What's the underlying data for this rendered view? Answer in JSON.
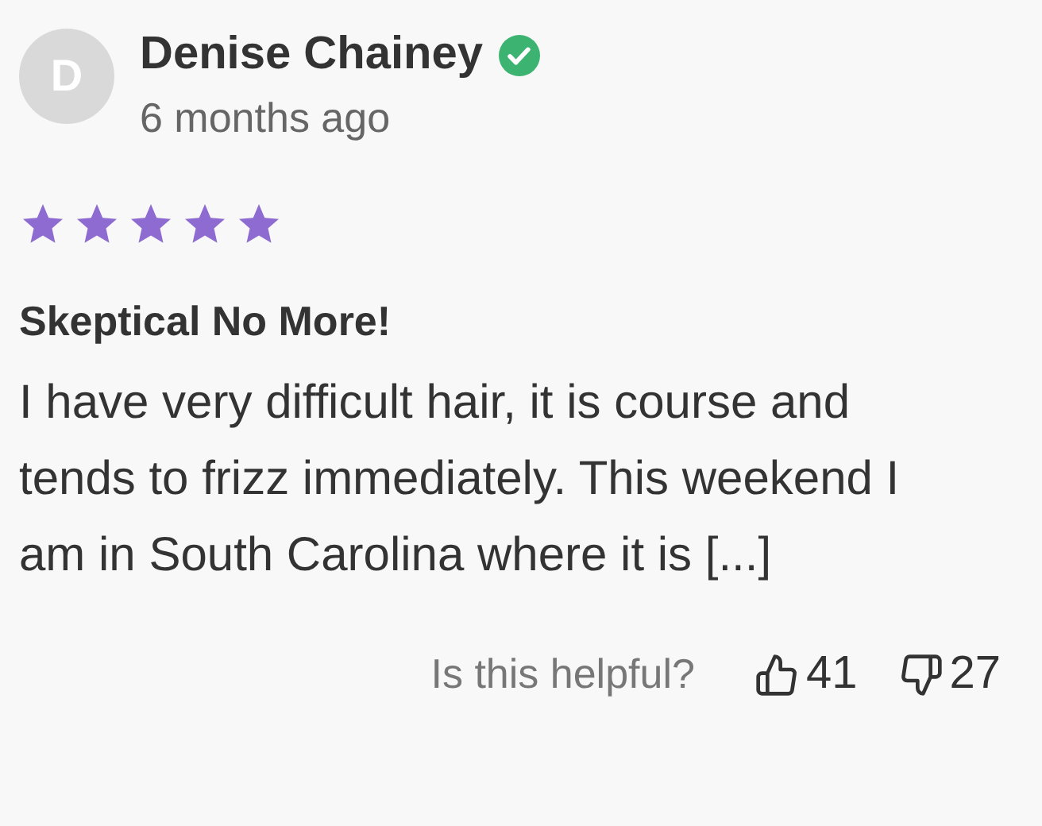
{
  "review": {
    "avatar_initial": "D",
    "author": "Denise Chainey",
    "verified": true,
    "date": "6 months ago",
    "stars": 5,
    "title": "Skeptical No More!",
    "body": "I have very difficult hair, it is course and tends to frizz immediately. This weekend I am in South Carolina where it is [...]"
  },
  "footer": {
    "prompt": "Is this helpful?",
    "upvotes": "41",
    "downvotes": "27"
  }
}
